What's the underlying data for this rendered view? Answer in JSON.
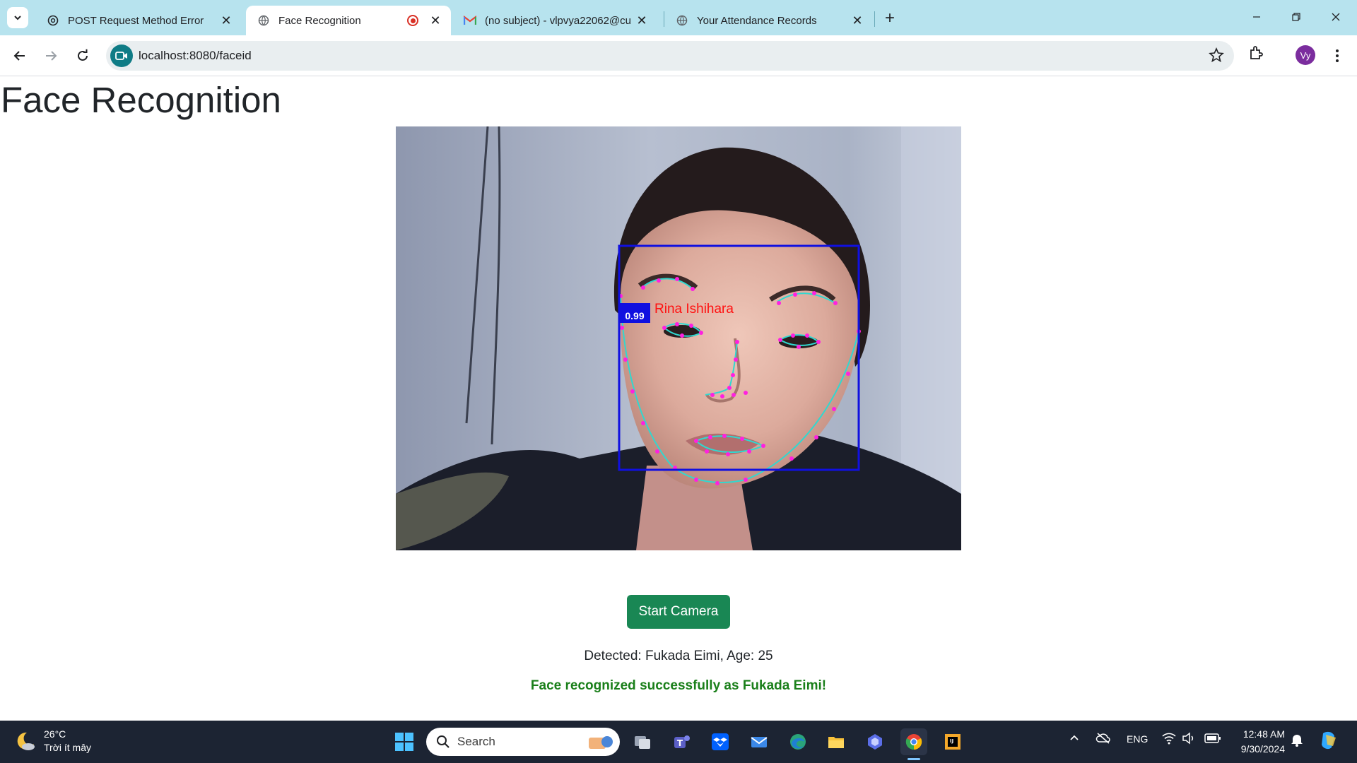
{
  "browser": {
    "tabs": [
      {
        "title": "POST Request Method Error",
        "favicon": "openai-icon",
        "active": false
      },
      {
        "title": "Face Recognition",
        "favicon": "globe-icon",
        "active": true,
        "recording": true
      },
      {
        "title": "(no subject) - vlpvya22062@cu",
        "favicon": "gmail-icon",
        "active": false
      },
      {
        "title": "Your Attendance Records",
        "favicon": "globe-icon",
        "active": false
      }
    ],
    "address": "localhost:8080/faceid",
    "profile_initials": "Vy"
  },
  "page": {
    "title": "Face Recognition",
    "overlay": {
      "name_label": "Rina Ishihara",
      "confidence": "0.99",
      "box_color": "#1010e0",
      "label_color": "#ff1010",
      "landmark_color": "#ff20e0",
      "contour_color": "#30d8d0"
    },
    "start_button": "Start Camera",
    "detected_text": "Detected: Fukada Eimi, Age: 25",
    "success_text": "Face recognized successfully as Fukada Eimi!",
    "button_color": "#198754",
    "success_color": "#1a7f1a"
  },
  "taskbar": {
    "weather_temp": "26°C",
    "weather_desc": "Trời ít mây",
    "search_label": "Search",
    "language": "ENG",
    "time": "12:48 AM",
    "date": "9/30/2024",
    "apps": [
      "windows-start-icon",
      "task-view-icon",
      "teams-icon",
      "dropbox-icon",
      "mail-icon",
      "edge-icon",
      "file-explorer-icon",
      "copilot-icon",
      "chrome-icon",
      "intellij-icon"
    ]
  }
}
